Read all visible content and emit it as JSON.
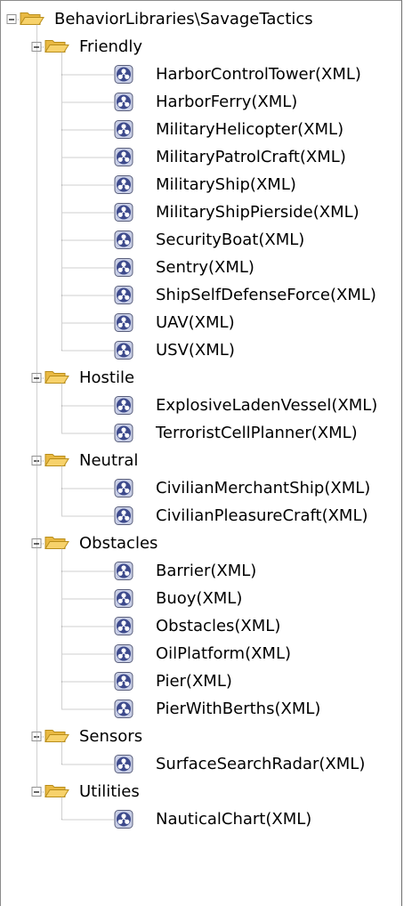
{
  "tree": {
    "root": {
      "label": "BehaviorLibraries\\SavageTactics",
      "expanded": true,
      "icon": "open-folder-icon",
      "folders": [
        {
          "label": "Friendly",
          "expanded": true,
          "icon": "open-folder-icon",
          "items": [
            "HarborControlTower(XML)",
            "HarborFerry(XML)",
            "MilitaryHelicopter(XML)",
            "MilitaryPatrolCraft(XML)",
            "MilitaryShip(XML)",
            "MilitaryShipPierside(XML)",
            "SecurityBoat(XML)",
            "Sentry(XML)",
            "ShipSelfDefenseForce(XML)",
            "UAV(XML)",
            "USV(XML)"
          ]
        },
        {
          "label": "Hostile",
          "expanded": true,
          "icon": "open-folder-icon",
          "items": [
            "ExplosiveLadenVessel(XML)",
            "TerroristCellPlanner(XML)"
          ]
        },
        {
          "label": "Neutral",
          "expanded": true,
          "icon": "open-folder-icon",
          "items": [
            "CivilianMerchantShip(XML)",
            "CivilianPleasureCraft(XML)"
          ]
        },
        {
          "label": "Obstacles",
          "expanded": true,
          "icon": "open-folder-icon",
          "items": [
            "Barrier(XML)",
            "Buoy(XML)",
            "Obstacles(XML)",
            "OilPlatform(XML)",
            "Pier(XML)",
            "PierWithBerths(XML)"
          ]
        },
        {
          "label": "Sensors",
          "expanded": true,
          "icon": "open-folder-icon",
          "items": [
            "SurfaceSearchRadar(XML)"
          ]
        },
        {
          "label": "Utilities",
          "expanded": true,
          "icon": "open-folder-icon",
          "items": [
            "NauticalChart(XML)"
          ]
        }
      ]
    },
    "item_icon": "behavior-network-icon",
    "colors": {
      "folder_fill": "#f7d26b",
      "folder_stroke": "#b98e1b",
      "item_icon_fill": "#3d4a8c",
      "item_icon_ring": "#c9cfe6",
      "connector": "#a0a0a0",
      "expander_border": "#919191"
    }
  }
}
